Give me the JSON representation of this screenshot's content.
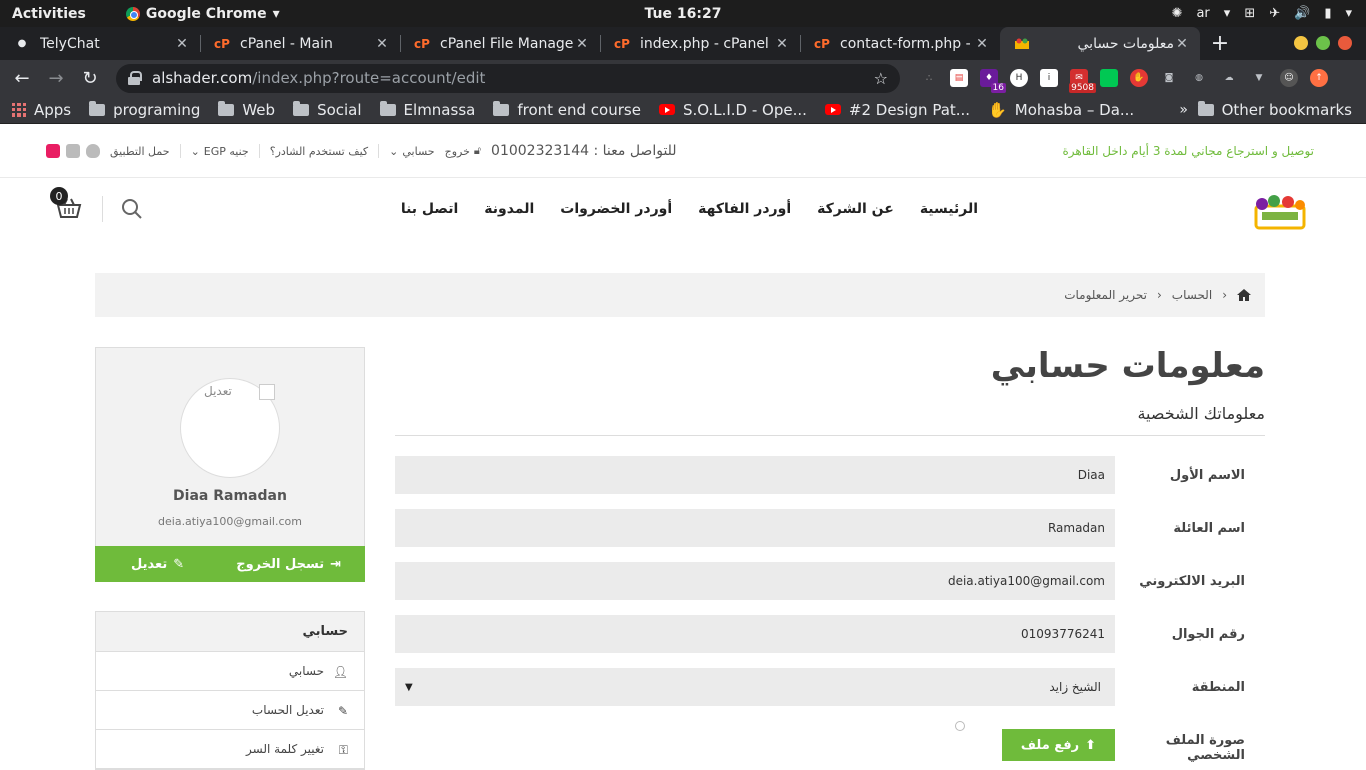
{
  "gnome": {
    "activities": "Activities",
    "app_name": "Google Chrome",
    "clock": "Tue 16:27",
    "lang": "ar"
  },
  "tabs": [
    {
      "title": "TelyChat",
      "icon": "dot-icon"
    },
    {
      "title": "cPanel - Main",
      "icon": "cpanel-icon"
    },
    {
      "title": "cPanel File Manager",
      "icon": "cpanel-icon"
    },
    {
      "title": "index.php - cPanel F",
      "icon": "cpanel-icon"
    },
    {
      "title": "contact-form.php - c",
      "icon": "cpanel-icon"
    },
    {
      "title": "معلومات حسابي",
      "icon": "shop-icon",
      "active": true
    }
  ],
  "omnibox": {
    "host": "alshader.com",
    "path": "/index.php?route=account/edit"
  },
  "extensions": {
    "badge_purple": "16",
    "badge_red": "9508"
  },
  "bookmarks": {
    "apps": "Apps",
    "items": [
      "programing",
      "Web",
      "Social",
      "Elmnassa",
      "front end course"
    ],
    "videos": [
      "S.O.L.I.D - Ope...",
      "#2 Design Pat..."
    ],
    "mohasba": "Mohasba – Da...",
    "more": "»",
    "other": "Other bookmarks"
  },
  "topstrip": {
    "promo": "توصيل و استرجاع مجاني لمدة 3 أيام داخل القاهرة",
    "contact": "للتواصل معنا : 01002323144",
    "logout": "خروج",
    "account": "حسابي",
    "how_to": "كيف تستخدم الشادر؟",
    "currency": "جنيه EGP",
    "download_app": "حمل التطبيق"
  },
  "nav": [
    "الرئيسية",
    "عن الشركة",
    "أوردر الفاكهة",
    "أوردر الخضروات",
    "المدونة",
    "اتصل بنا"
  ],
  "cart_count": "0",
  "breadcrumb": [
    "الحساب",
    "تحرير المعلومات"
  ],
  "page_title": "معلومات حسابي",
  "section_title": "معلوماتك الشخصية",
  "form": [
    {
      "label": "الاسم الأول",
      "value": "Diaa"
    },
    {
      "label": "اسم العائلة",
      "value": "Ramadan"
    },
    {
      "label": "البريد الالكتروني",
      "value": "deia.atiya100@gmail.com"
    },
    {
      "label": "رقم الجوال",
      "value": "01093776241"
    },
    {
      "label": "المنطقة",
      "value": "الشيخ زايد"
    }
  ],
  "upload": {
    "label": "صورة الملف الشخصي",
    "button": "رفع ملف"
  },
  "profile": {
    "edit_photo": "تعديل",
    "name": "Diaa Ramadan",
    "email": "deia.atiya100@gmail.com",
    "logout": "تسجل الخروج",
    "edit": "تعديل"
  },
  "account_menu": {
    "title": "حسابي",
    "items": [
      "حسابي",
      "تعديل الحساب",
      "تغيير كلمة السر"
    ]
  },
  "colors": {
    "brand_green": "#6fbb3b",
    "chrome_dark": "#202124",
    "chrome_mid": "#35363a"
  }
}
